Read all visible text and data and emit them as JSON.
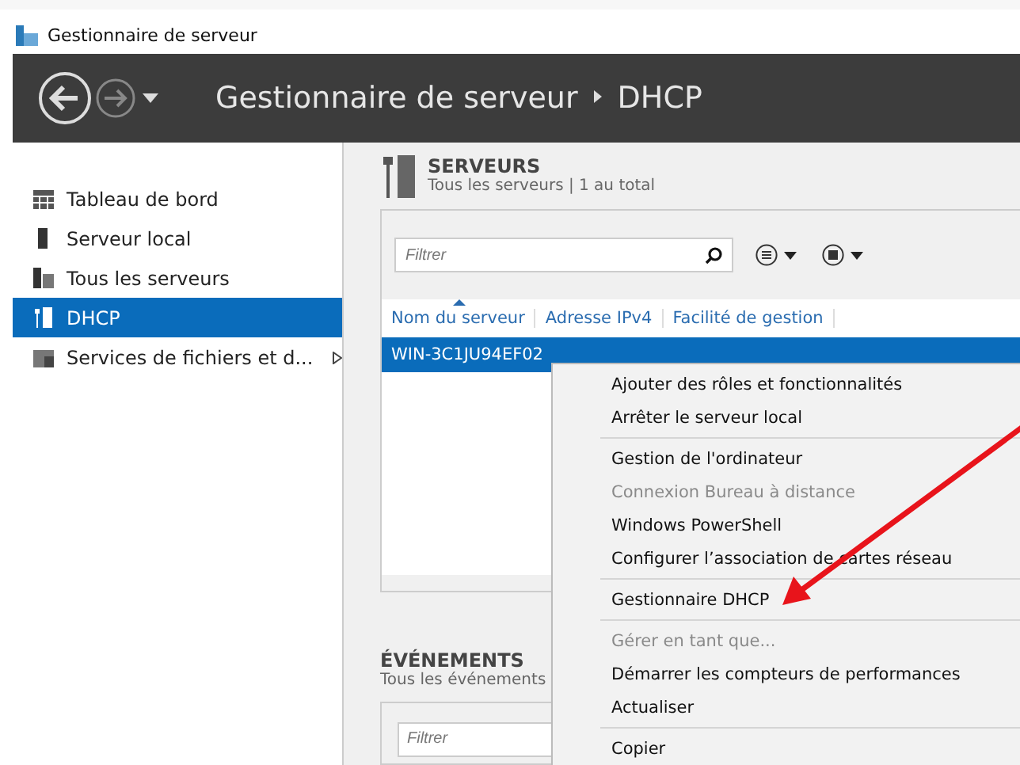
{
  "window": {
    "title": "Gestionnaire de serveur"
  },
  "header": {
    "breadcrumb": [
      "Gestionnaire de serveur",
      "DHCP"
    ]
  },
  "sidebar": {
    "items": [
      {
        "label": "Tableau de bord",
        "selected": false,
        "has_submenu": false
      },
      {
        "label": "Serveur local",
        "selected": false,
        "has_submenu": false
      },
      {
        "label": "Tous les serveurs",
        "selected": false,
        "has_submenu": false
      },
      {
        "label": "DHCP",
        "selected": true,
        "has_submenu": false
      },
      {
        "label": "Services de fichiers et d...",
        "selected": false,
        "has_submenu": true
      }
    ]
  },
  "servers": {
    "title": "SERVEURS",
    "subtitle": "Tous les serveurs | 1 au total",
    "filter": {
      "placeholder": "Filtrer"
    },
    "columns": [
      {
        "label": "Nom du serveur",
        "sorted": true
      },
      {
        "label": "Adresse IPv4",
        "sorted": false
      },
      {
        "label": "Facilité de gestion",
        "sorted": false
      }
    ],
    "rows": [
      {
        "name": "WIN-3C1JU94EF02",
        "selected": true
      }
    ]
  },
  "events": {
    "title": "ÉVÉNEMENTS",
    "subtitle": "Tous les événements",
    "filter": {
      "placeholder": "Filtrer"
    }
  },
  "context_menu": {
    "groups": [
      [
        {
          "label": "Ajouter des rôles et fonctionnalités",
          "disabled": false
        },
        {
          "label": "Arrêter le serveur local",
          "disabled": false
        }
      ],
      [
        {
          "label": "Gestion de l'ordinateur",
          "disabled": false
        },
        {
          "label": "Connexion Bureau à distance",
          "disabled": true
        },
        {
          "label": "Windows PowerShell",
          "disabled": false
        },
        {
          "label": "Configurer l’association de cartes réseau",
          "disabled": false
        }
      ],
      [
        {
          "label": "Gestionnaire DHCP",
          "disabled": false
        }
      ],
      [
        {
          "label": "Gérer en tant que...",
          "disabled": true
        },
        {
          "label": "Démarrer les compteurs de performances",
          "disabled": false
        },
        {
          "label": "Actualiser",
          "disabled": false
        }
      ],
      [
        {
          "label": "Copier",
          "disabled": false
        }
      ]
    ]
  }
}
